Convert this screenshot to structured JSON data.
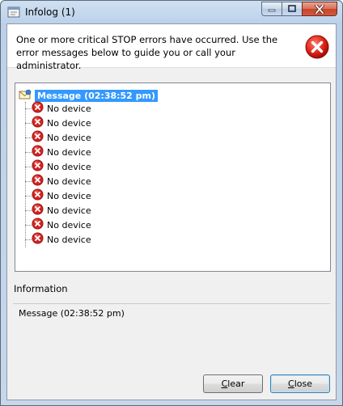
{
  "window": {
    "title": "Infolog (1)"
  },
  "header": {
    "message": "One or more critical STOP errors have occurred. Use the error messages below to guide you or call your administrator."
  },
  "tree": {
    "root_label": "Message (02:38:52 pm)",
    "items": [
      {
        "label": "No device"
      },
      {
        "label": "No device"
      },
      {
        "label": "No device"
      },
      {
        "label": "No device"
      },
      {
        "label": "No device"
      },
      {
        "label": "No device"
      },
      {
        "label": "No device"
      },
      {
        "label": "No device"
      },
      {
        "label": "No device"
      },
      {
        "label": "No device"
      }
    ]
  },
  "information": {
    "heading": "Information",
    "text": "Message (02:38:52 pm)"
  },
  "buttons": {
    "clear_first": "C",
    "clear_rest": "lear",
    "close_first": "C",
    "close_rest": "lose"
  },
  "icons": {
    "app": "infolog-icon",
    "header": "error-icon",
    "root": "message-envelope-icon",
    "item": "error-icon"
  },
  "colors": {
    "selection": "#3399ff",
    "error_red": "#d32222",
    "title_close": "#c7452a"
  }
}
